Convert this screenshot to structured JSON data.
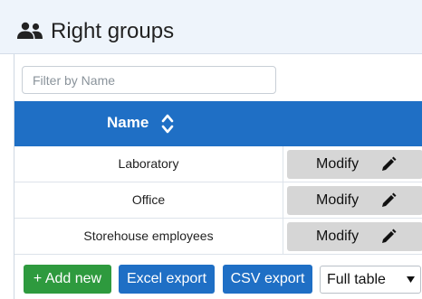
{
  "header": {
    "title": "Right groups",
    "icon": "users-icon"
  },
  "filter": {
    "placeholder": "Filter by Name",
    "value": ""
  },
  "table": {
    "columns": [
      {
        "label": "Name",
        "sort_icon": "sort-icon"
      }
    ],
    "rows": [
      {
        "name": "Laboratory",
        "action_label": "Modify"
      },
      {
        "name": "Office",
        "action_label": "Modify"
      },
      {
        "name": "Storehouse employees",
        "action_label": "Modify"
      }
    ],
    "action_icon": "pencil-icon"
  },
  "toolbar": {
    "add_label": "+ Add new",
    "excel_label": "Excel export",
    "csv_label": "CSV export",
    "view_select": {
      "selected": "Full table"
    }
  },
  "colors": {
    "primary": "#1f6fc5",
    "success": "#2e9a3e",
    "header_bg": "#eef4fb",
    "button_gray": "#d6d6d6"
  }
}
